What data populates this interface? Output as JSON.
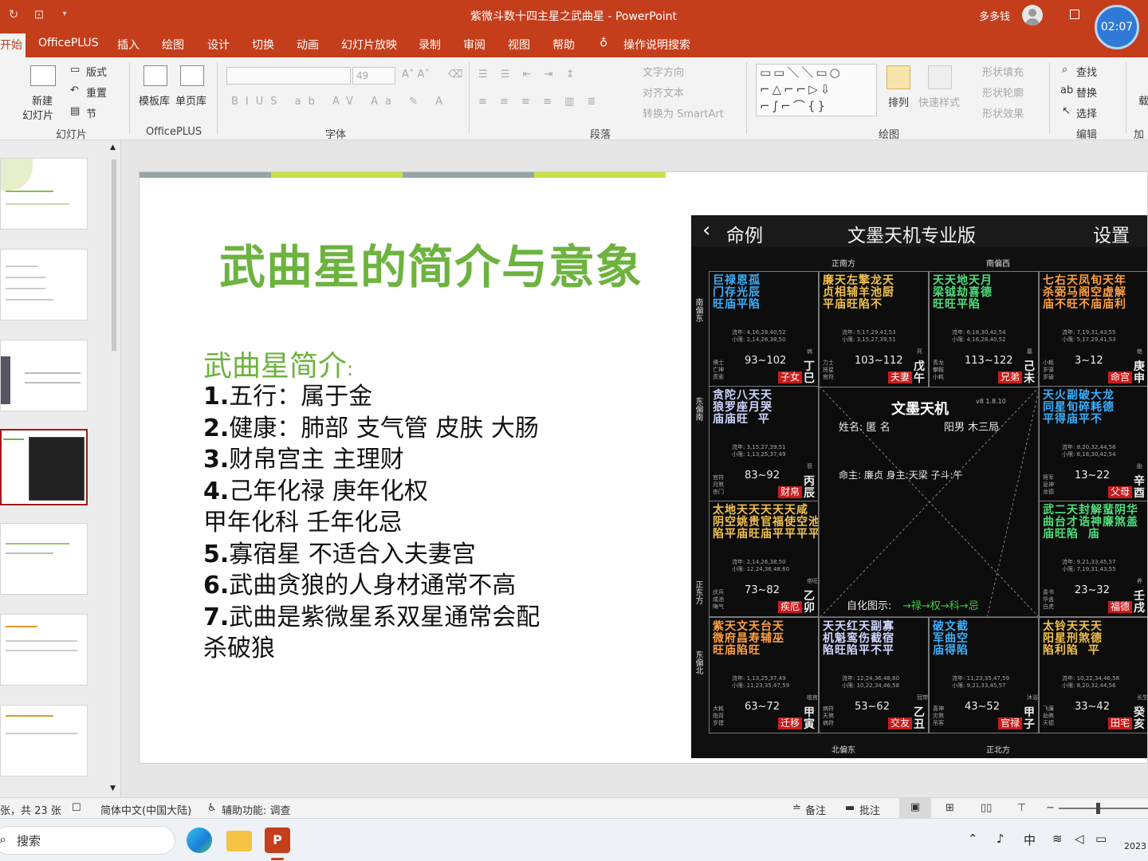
{
  "window": {
    "title": "紫微斗数十四主星之武曲星  -  PowerPoint",
    "user": "多多钱",
    "clock": "02:07"
  },
  "menu": {
    "tabs": [
      "开始",
      "OfficePLUS",
      "插入",
      "绘图",
      "设计",
      "切换",
      "动画",
      "幻灯片放映",
      "录制",
      "审阅",
      "视图",
      "帮助"
    ],
    "tell_me": "操作说明搜索"
  },
  "ribbon": {
    "slides": {
      "new_slide": "新建",
      "new_slide2": "幻灯片",
      "layout": "版式",
      "reset": "重置",
      "section": "节",
      "group": "幻灯片"
    },
    "officeplus": {
      "template": "模板库",
      "single": "单页库",
      "group": "OfficePLUS"
    },
    "font": {
      "size": "49",
      "group": "字体"
    },
    "paragraph": {
      "text_dir": "文字方向",
      "align_text": "对齐文本",
      "smartart": "转换为 SmartArt",
      "group": "段落"
    },
    "drawing": {
      "arrange": "排列",
      "quick_styles": "快速样式",
      "fill": "形状填充",
      "outline": "形状轮廓",
      "effects": "形状效果",
      "group": "绘图"
    },
    "editing": {
      "find": "查找",
      "replace": "替换",
      "select": "选择",
      "group": "编辑"
    },
    "addins": {
      "label1": "加",
      "label2": "载"
    }
  },
  "slide": {
    "title": "武曲星的简介与意象",
    "intro": "武曲星简介",
    "intro_colon": ":",
    "points": [
      {
        "num": "1.",
        "text": "五行：属于金"
      },
      {
        "num": "2.",
        "text": "健康：肺部 支气管 皮肤 大肠"
      },
      {
        "num": "3.",
        "text": "财帛宫主 主理财"
      },
      {
        "num": "4.",
        "text": "己年化禄 庚年化权"
      },
      {
        "num": "",
        "text": "  甲年化科  壬年化忌"
      },
      {
        "num": "5.",
        "text": "寡宿星 不适合入夫妻宫"
      },
      {
        "num": "6.",
        "text": "武曲贪狼的人身材通常不高"
      },
      {
        "num": "7.",
        "text": "武曲是紫微星系双星通常会配"
      },
      {
        "num": "",
        "text": "杀破狼"
      }
    ]
  },
  "chart": {
    "back": "命例",
    "title": "文墨天机专业版",
    "settings": "设置",
    "directions": {
      "top": "正南方",
      "top_right": "南偏西",
      "left_top": "南偏东",
      "left_mid": "东偏南",
      "left_low": "正东方",
      "left_bottom": "东偏北",
      "bottom": "北偏东",
      "bottom_right": "正北方"
    },
    "center": {
      "brand": "文墨天机",
      "ver": "v8 1.8.10",
      "name": "姓名: 匿 名",
      "gender": "阳男 木三局",
      "ming": "命主: 廉贞 身主:天梁 子斗:午",
      "sihua_label": "自化图示:",
      "sihua": "→禄→权→科→忌"
    },
    "cells": [
      {
        "stars": "巨禄恩孤\n门存光辰\n旺庙平陷",
        "range": "93~102",
        "palace": "子女",
        "gz": "丁巳",
        "sm": "博士\n亡神\n贯索",
        "flow": "流年: 4,16,28,40,52\n小限: 2,14,26,38,50",
        "age": "病"
      },
      {
        "stars": "廉天左擎龙天\n贞相辅羊池厨\n平庙旺陷不",
        "range": "103~112",
        "palace": "夫妻",
        "gz": "戊午",
        "sm": "力士\n将星\n官符",
        "flow": "流年: 5,17,29,41,53\n小限: 3,15,27,39,51",
        "age": "死"
      },
      {
        "stars": "天天地天月\n梁钺劫喜德\n旺旺平陷",
        "range": "113~122",
        "palace": "兄弟",
        "gz": "己未",
        "sm": "青龙\n攀鞍\n小耗",
        "flow": "流年: 6,18,30,42,54\n小限: 4,16,28,40,52",
        "age": "墓"
      },
      {
        "stars": "七右天凤旬天年\n杀弼马阁空虚解\n庙不旺不庙庙利",
        "range": "3~12",
        "palace": "命宫",
        "gz": "庚申",
        "sm": "小耗\n岁驿\n岁破",
        "flow": "流年: 7,19,31,43,55\n小限: 5,17,29,41,53",
        "age": "绝"
      },
      {
        "stars": "贪陀八天天\n狼罗座月哭\n庙庙旺  平",
        "range": "83~92",
        "palace": "财帛",
        "gz": "丙辰",
        "sm": "官符\n月煞\n丧门",
        "flow": "流年: 3,15,27,39,51\n小限: 1,13,25,37,49",
        "age": "衰"
      },
      {
        "stars": "天火副破大龙\n同星旬碎耗德\n平得庙平不",
        "range": "13~22",
        "palace": "父母",
        "gz": "辛酉",
        "sm": "将军\n息神\n龙德",
        "flow": "流年: 8,20,32,44,56\n小限: 6,18,30,42,54",
        "age": "胎"
      },
      {
        "stars": "太地天天天天天咸\n阴空姚贵官福使空池\n陷平庙旺庙平平平平",
        "range": "73~82",
        "palace": "疾厄",
        "gz": "乙卯",
        "sm": "伏兵\n咸池\n晦气",
        "flow": "流年: 2,14,26,38,50\n小限: 12,24,36,48,60",
        "age": "帝旺"
      },
      {
        "stars": "武二天封解蜚阴华\n曲台才诰神廉煞盖\n庙旺陷  庙",
        "range": "23~32",
        "palace": "福德",
        "gz": "壬戌",
        "sm": "奏书\n华盖\n白虎",
        "flow": "流年: 9,21,33,45,57\n小限: 7,19,31,43,55",
        "age": "养"
      },
      {
        "stars": "紫天文天台天\n微府昌寿辅巫\n旺庙陷旺",
        "range": "63~72",
        "palace": "迁移",
        "gz": "甲寅",
        "sm": "大耗\n指背\n岁建",
        "flow": "流年: 1,13,25,37,49\n小限: 11,23,35,47,59",
        "age": "临官"
      },
      {
        "stars": "天天红天副寡\n机魁鸾伤截宿\n陷旺陷平不平",
        "range": "53~62",
        "palace": "交友",
        "gz": "乙丑",
        "sm": "病符\n天煞\n病符",
        "flow": "流年: 12,24,36,48,60\n小限: 10,22,34,46,58",
        "age": "冠带"
      },
      {
        "stars": "破文截\n军曲空\n庙得陷",
        "range": "43~52",
        "palace": "官禄",
        "gz": "甲子",
        "sm": "喜神\n灾煞\n吊客",
        "flow": "流年: 11,23,35,47,59\n小限: 9,21,33,45,57",
        "age": "沐浴"
      },
      {
        "stars": "太铃天天天\n阳星刑煞德\n陷利陷  平",
        "range": "33~42",
        "palace": "田宅",
        "gz": "癸亥",
        "sm": "飞廉\n劫煞\n天德",
        "flow": "流年: 10,22,34,46,58\n小限: 8,20,32,44,56",
        "age": "长生"
      }
    ]
  },
  "status": {
    "slide_info": "张，共 23 张",
    "lang": "简体中文(中国大陆)",
    "access": "辅助功能: 调查",
    "notes": "备注",
    "comments": "批注"
  },
  "taskbar": {
    "search": "搜索",
    "ime": "中",
    "year": "2023"
  }
}
